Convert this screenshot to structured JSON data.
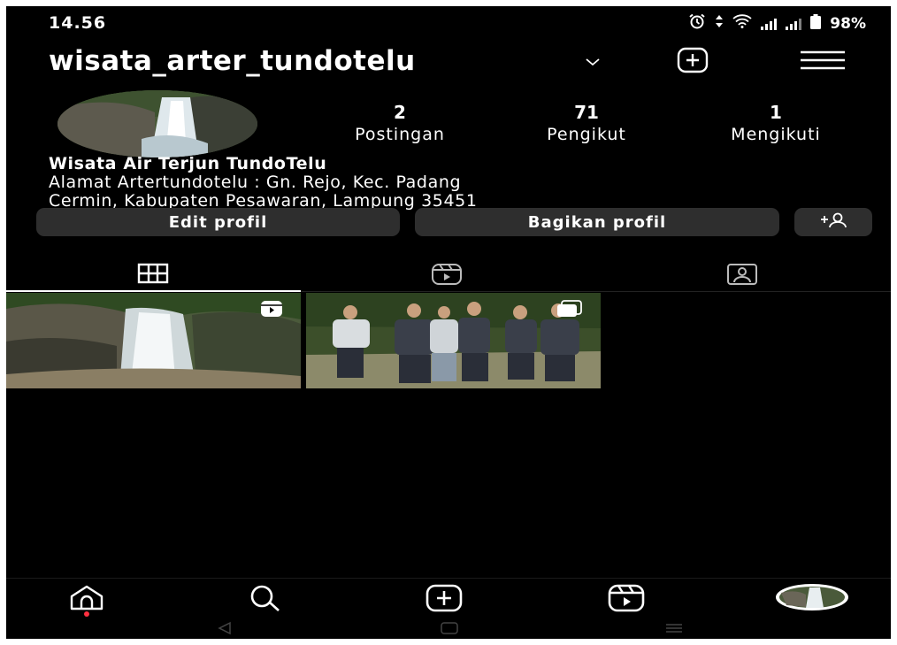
{
  "status": {
    "time": "14.56",
    "battery": "98%"
  },
  "header": {
    "username": "wisata_arter_tundotelu"
  },
  "profile": {
    "stats": [
      {
        "value": "2",
        "label": "Postingan"
      },
      {
        "value": "71",
        "label": "Pengikut"
      },
      {
        "value": "1",
        "label": "Mengikuti"
      }
    ],
    "name": "Wisata Air Terjun TundoTelu",
    "bio_lines": [
      "Alamat Artertundotelu : Gn. Rejo, Kec. Padang",
      "Cermin, Kabupaten Pesawaran, Lampung 35451"
    ]
  },
  "actions": {
    "edit": "Edit profil",
    "share": "Bagikan profil"
  },
  "tabs": [
    "grid-icon",
    "reels-icon",
    "tagged-icon"
  ],
  "posts": [
    {
      "subject": "waterfall",
      "badge": "reels-icon"
    },
    {
      "subject": "group-photo",
      "badge": "multi-icon"
    }
  ],
  "bottom_nav": [
    "home-icon",
    "search-icon",
    "create-icon",
    "reels-icon",
    "profile-avatar"
  ],
  "colors": {
    "background": "#000000",
    "text": "#ffffff",
    "button": "#2e2e2e",
    "notification": "#ff3040"
  }
}
